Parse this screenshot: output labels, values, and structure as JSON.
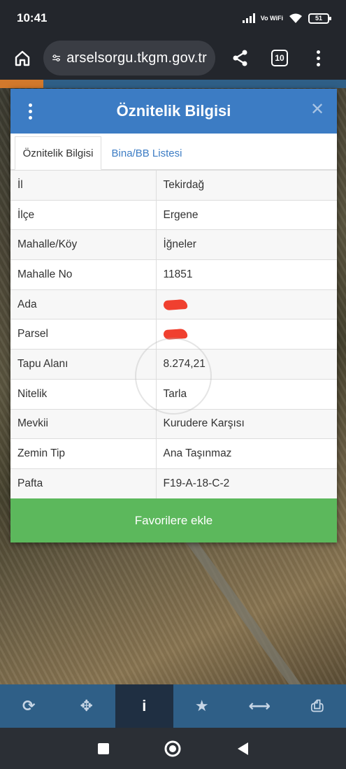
{
  "status_bar": {
    "time": "10:41",
    "network": "Vo WiFi",
    "battery": "51"
  },
  "browser": {
    "url": "arselsorgu.tkgm.gov.tr",
    "tab_count": "10"
  },
  "dialog": {
    "title": "Öznitelik Bilgisi",
    "tabs": [
      {
        "label": "Öznitelik Bilgisi",
        "active": true
      },
      {
        "label": "Bina/BB Listesi",
        "active": false
      }
    ],
    "rows": [
      {
        "key": "İl",
        "value": "Tekirdağ"
      },
      {
        "key": "İlçe",
        "value": "Ergene"
      },
      {
        "key": "Mahalle/Köy",
        "value": "İğneler"
      },
      {
        "key": "Mahalle No",
        "value": "11851"
      },
      {
        "key": "Ada",
        "value": "",
        "redacted": true
      },
      {
        "key": "Parsel",
        "value": "",
        "redacted": true
      },
      {
        "key": "Tapu Alanı",
        "value": "8.274,21"
      },
      {
        "key": "Nitelik",
        "value": "Tarla"
      },
      {
        "key": "Mevkii",
        "value": "Kurudere Karşısı"
      },
      {
        "key": "Zemin Tip",
        "value": "Ana Taşınmaz"
      },
      {
        "key": "Pafta",
        "value": "F19-A-18-C-2"
      }
    ],
    "favorite_button": "Favorilere ekle"
  },
  "toolbar": {
    "items": [
      {
        "name": "refresh",
        "glyph": "⟳"
      },
      {
        "name": "locate",
        "glyph": "✥"
      },
      {
        "name": "info",
        "glyph": "i",
        "active": true
      },
      {
        "name": "favorites",
        "glyph": "★"
      },
      {
        "name": "measure",
        "glyph": "⟷"
      },
      {
        "name": "print",
        "glyph": "⎙"
      }
    ]
  },
  "colors": {
    "header": "#3c7cc4",
    "favorite": "#5cb85c",
    "toolbar": "#2f5f87",
    "redaction": "#f0402f"
  }
}
